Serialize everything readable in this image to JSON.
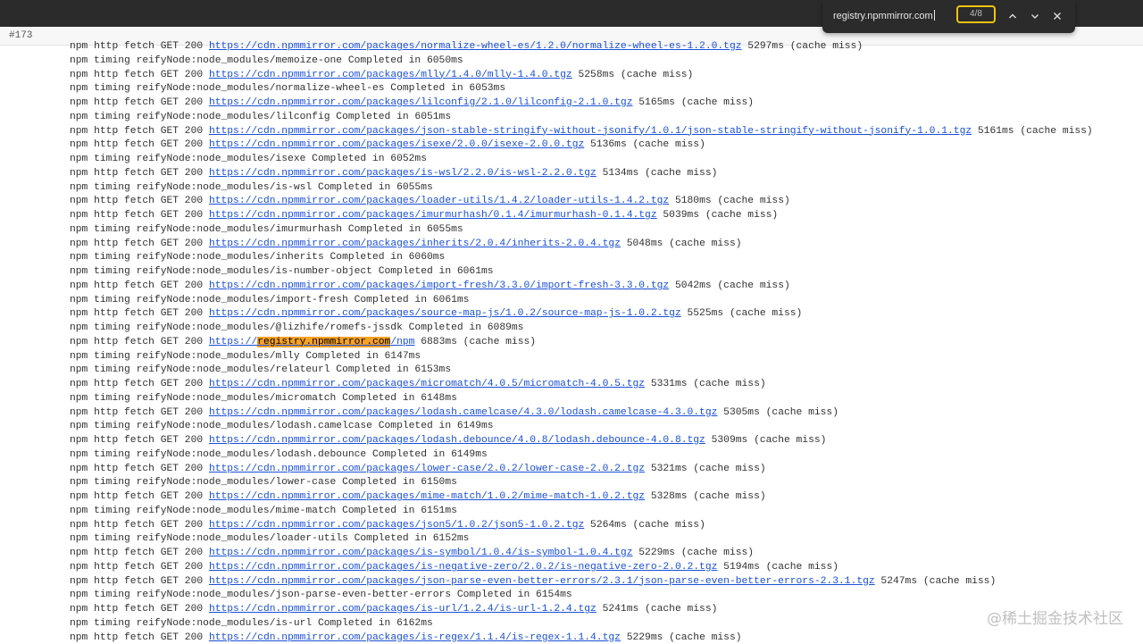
{
  "header": {
    "build_id": "#173"
  },
  "find_bar": {
    "query": "registry.npmmirror.com",
    "count": "4/8",
    "icons": [
      "chevron-up-icon",
      "chevron-down-icon",
      "close-icon"
    ]
  },
  "log": {
    "highlight_color": "#f6a126",
    "link_color": "#1a4fd8",
    "lines": [
      {
        "prefix": "npm http fetch GET 200 ",
        "url": "https://cdn.npmmirror.com/packages/normalize-wheel-es/1.2.0/normalize-wheel-es-1.2.0.tgz",
        "suffix": " 5297ms (cache miss)"
      },
      {
        "text": "npm timing reifyNode:node_modules/memoize-one Completed in 6050ms"
      },
      {
        "prefix": "npm http fetch GET 200 ",
        "url": "https://cdn.npmmirror.com/packages/mlly/1.4.0/mlly-1.4.0.tgz",
        "suffix": " 5258ms (cache miss)"
      },
      {
        "text": "npm timing reifyNode:node_modules/normalize-wheel-es Completed in 6053ms"
      },
      {
        "prefix": "npm http fetch GET 200 ",
        "url": "https://cdn.npmmirror.com/packages/lilconfig/2.1.0/lilconfig-2.1.0.tgz",
        "suffix": " 5165ms (cache miss)"
      },
      {
        "text": "npm timing reifyNode:node_modules/lilconfig Completed in 6051ms"
      },
      {
        "prefix": "npm http fetch GET 200 ",
        "url": "https://cdn.npmmirror.com/packages/json-stable-stringify-without-jsonify/1.0.1/json-stable-stringify-without-jsonify-1.0.1.tgz",
        "suffix": " 5161ms (cache miss)"
      },
      {
        "prefix": "npm http fetch GET 200 ",
        "url": "https://cdn.npmmirror.com/packages/isexe/2.0.0/isexe-2.0.0.tgz",
        "suffix": " 5136ms (cache miss)"
      },
      {
        "text": "npm timing reifyNode:node_modules/isexe Completed in 6052ms"
      },
      {
        "prefix": "npm http fetch GET 200 ",
        "url": "https://cdn.npmmirror.com/packages/is-wsl/2.2.0/is-wsl-2.2.0.tgz",
        "suffix": " 5134ms (cache miss)"
      },
      {
        "text": "npm timing reifyNode:node_modules/is-wsl Completed in 6055ms"
      },
      {
        "prefix": "npm http fetch GET 200 ",
        "url": "https://cdn.npmmirror.com/packages/loader-utils/1.4.2/loader-utils-1.4.2.tgz",
        "suffix": " 5180ms (cache miss)"
      },
      {
        "prefix": "npm http fetch GET 200 ",
        "url": "https://cdn.npmmirror.com/packages/imurmurhash/0.1.4/imurmurhash-0.1.4.tgz",
        "suffix": " 5039ms (cache miss)"
      },
      {
        "text": "npm timing reifyNode:node_modules/imurmurhash Completed in 6055ms"
      },
      {
        "prefix": "npm http fetch GET 200 ",
        "url": "https://cdn.npmmirror.com/packages/inherits/2.0.4/inherits-2.0.4.tgz",
        "suffix": " 5048ms (cache miss)"
      },
      {
        "text": "npm timing reifyNode:node_modules/inherits Completed in 6060ms"
      },
      {
        "text": "npm timing reifyNode:node_modules/is-number-object Completed in 6061ms"
      },
      {
        "prefix": "npm http fetch GET 200 ",
        "url": "https://cdn.npmmirror.com/packages/import-fresh/3.3.0/import-fresh-3.3.0.tgz",
        "suffix": " 5042ms (cache miss)"
      },
      {
        "text": "npm timing reifyNode:node_modules/import-fresh Completed in 6061ms"
      },
      {
        "prefix": "npm http fetch GET 200 ",
        "url": "https://cdn.npmmirror.com/packages/source-map-js/1.0.2/source-map-js-1.0.2.tgz",
        "suffix": " 5525ms (cache miss)"
      },
      {
        "text": "npm timing reifyNode:node_modules/@lizhife/romefs-jssdk Completed in 6089ms"
      },
      {
        "prefix": "npm http fetch GET 200 ",
        "url_parts": [
          "https://",
          "registry.npmmirror.com",
          "/npm"
        ],
        "suffix": " 6883ms (cache miss)"
      },
      {
        "text": "npm timing reifyNode:node_modules/mlly Completed in 6147ms"
      },
      {
        "text": "npm timing reifyNode:node_modules/relateurl Completed in 6153ms"
      },
      {
        "prefix": "npm http fetch GET 200 ",
        "url": "https://cdn.npmmirror.com/packages/micromatch/4.0.5/micromatch-4.0.5.tgz",
        "suffix": " 5331ms (cache miss)"
      },
      {
        "text": "npm timing reifyNode:node_modules/micromatch Completed in 6148ms"
      },
      {
        "prefix": "npm http fetch GET 200 ",
        "url": "https://cdn.npmmirror.com/packages/lodash.camelcase/4.3.0/lodash.camelcase-4.3.0.tgz",
        "suffix": " 5305ms (cache miss)"
      },
      {
        "text": "npm timing reifyNode:node_modules/lodash.camelcase Completed in 6149ms"
      },
      {
        "prefix": "npm http fetch GET 200 ",
        "url": "https://cdn.npmmirror.com/packages/lodash.debounce/4.0.8/lodash.debounce-4.0.8.tgz",
        "suffix": " 5309ms (cache miss)"
      },
      {
        "text": "npm timing reifyNode:node_modules/lodash.debounce Completed in 6149ms"
      },
      {
        "prefix": "npm http fetch GET 200 ",
        "url": "https://cdn.npmmirror.com/packages/lower-case/2.0.2/lower-case-2.0.2.tgz",
        "suffix": " 5321ms (cache miss)"
      },
      {
        "text": "npm timing reifyNode:node_modules/lower-case Completed in 6150ms"
      },
      {
        "prefix": "npm http fetch GET 200 ",
        "url": "https://cdn.npmmirror.com/packages/mime-match/1.0.2/mime-match-1.0.2.tgz",
        "suffix": " 5328ms (cache miss)"
      },
      {
        "text": "npm timing reifyNode:node_modules/mime-match Completed in 6151ms"
      },
      {
        "prefix": "npm http fetch GET 200 ",
        "url": "https://cdn.npmmirror.com/packages/json5/1.0.2/json5-1.0.2.tgz",
        "suffix": " 5264ms (cache miss)"
      },
      {
        "text": "npm timing reifyNode:node_modules/loader-utils Completed in 6152ms"
      },
      {
        "prefix": "npm http fetch GET 200 ",
        "url": "https://cdn.npmmirror.com/packages/is-symbol/1.0.4/is-symbol-1.0.4.tgz",
        "suffix": " 5229ms (cache miss)"
      },
      {
        "prefix": "npm http fetch GET 200 ",
        "url": "https://cdn.npmmirror.com/packages/is-negative-zero/2.0.2/is-negative-zero-2.0.2.tgz",
        "suffix": " 5194ms (cache miss)"
      },
      {
        "prefix": "npm http fetch GET 200 ",
        "url": "https://cdn.npmmirror.com/packages/json-parse-even-better-errors/2.3.1/json-parse-even-better-errors-2.3.1.tgz",
        "suffix": " 5247ms (cache miss)"
      },
      {
        "text": "npm timing reifyNode:node_modules/json-parse-even-better-errors Completed in 6154ms"
      },
      {
        "prefix": "npm http fetch GET 200 ",
        "url": "https://cdn.npmmirror.com/packages/is-url/1.2.4/is-url-1.2.4.tgz",
        "suffix": " 5241ms (cache miss)"
      },
      {
        "text": "npm timing reifyNode:node_modules/is-url Completed in 6162ms"
      },
      {
        "prefix": "npm http fetch GET 200 ",
        "url": "https://cdn.npmmirror.com/packages/is-regex/1.1.4/is-regex-1.1.4.tgz",
        "suffix": " 5229ms (cache miss)"
      }
    ]
  },
  "watermark": "@稀土掘金技术社区"
}
